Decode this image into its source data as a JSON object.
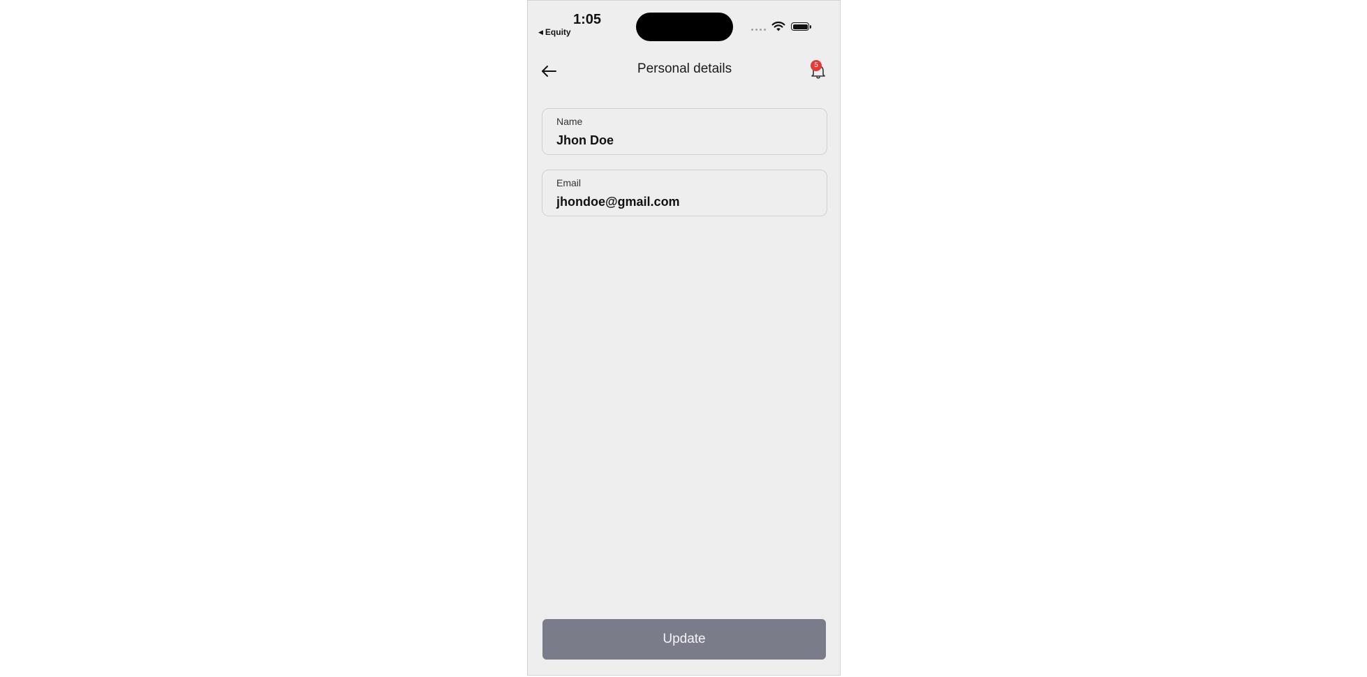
{
  "status_bar": {
    "time": "1:05",
    "back_app_label": "Equity"
  },
  "header": {
    "title": "Personal details",
    "notification_count": "5"
  },
  "form": {
    "name": {
      "label": "Name",
      "value": "Jhon Doe"
    },
    "email": {
      "label": "Email",
      "value": "jhondoe@gmail.com"
    }
  },
  "actions": {
    "update_label": "Update"
  },
  "colors": {
    "background": "#eeeeee",
    "button": "#7a7d89",
    "badge": "#e53935"
  }
}
